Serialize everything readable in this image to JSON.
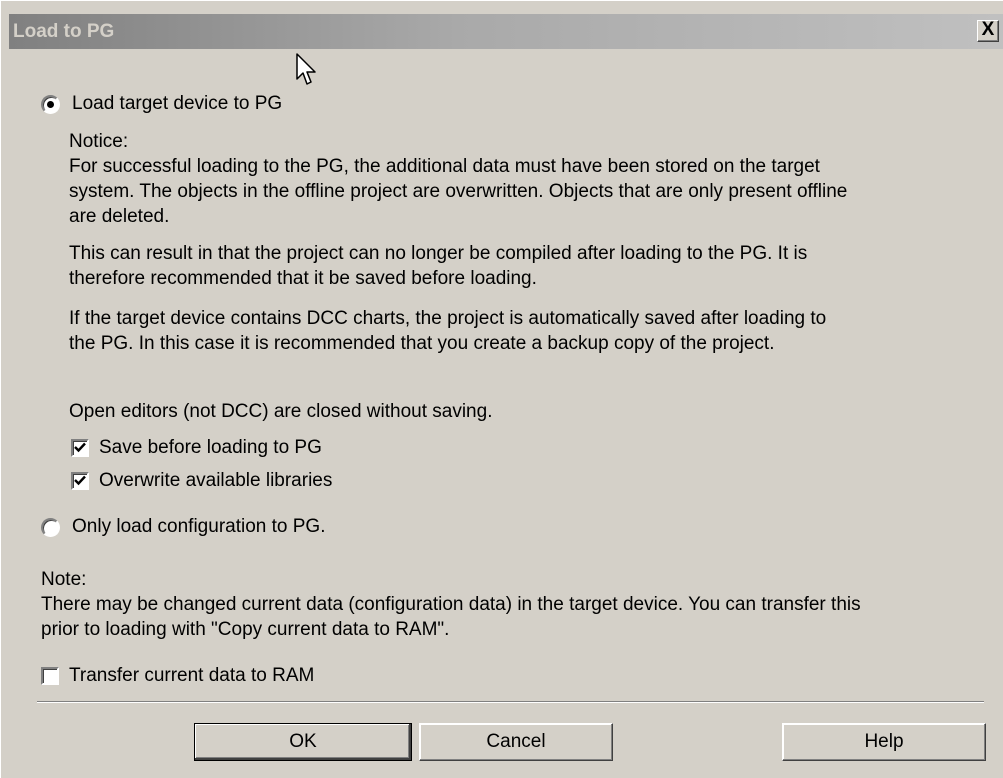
{
  "window": {
    "title": "Load to PG",
    "close_glyph": "X"
  },
  "options": {
    "load_target": {
      "label": "Load target device to PG",
      "selected": true
    },
    "only_config": {
      "label": "Only load configuration to PG.",
      "selected": false
    }
  },
  "notice": {
    "heading": "Notice:",
    "p1_line1": "For successful loading to the PG, the additional data must have been stored on the target",
    "p1_line2": "system. The objects in the offline project are overwritten. Objects that are only present offline",
    "p1_line3": "are deleted.",
    "p2_line1": "This can result in that the project can no longer be compiled after loading to the PG. It is",
    "p2_line2": "therefore recommended that it be saved before loading.",
    "p3_line1": "If the target device contains DCC charts, the project is automatically saved after loading to",
    "p3_line2": "the PG. In this case it is recommended that you create a backup copy of the project.",
    "editors_closed": "Open editors (not DCC) are closed without saving."
  },
  "checkboxes": {
    "save_before": {
      "label": "Save before loading to PG",
      "checked": true
    },
    "overwrite_libraries": {
      "label": "Overwrite available libraries",
      "checked": true
    },
    "transfer_ram": {
      "label": "Transfer current data to RAM",
      "checked": false
    }
  },
  "note": {
    "heading": "Note:",
    "line1": "There may be changed current data (configuration data) in the target device. You can transfer this",
    "line2": "prior to loading with \"Copy current data to RAM\"."
  },
  "buttons": {
    "ok": "OK",
    "cancel": "Cancel",
    "help": "Help"
  }
}
